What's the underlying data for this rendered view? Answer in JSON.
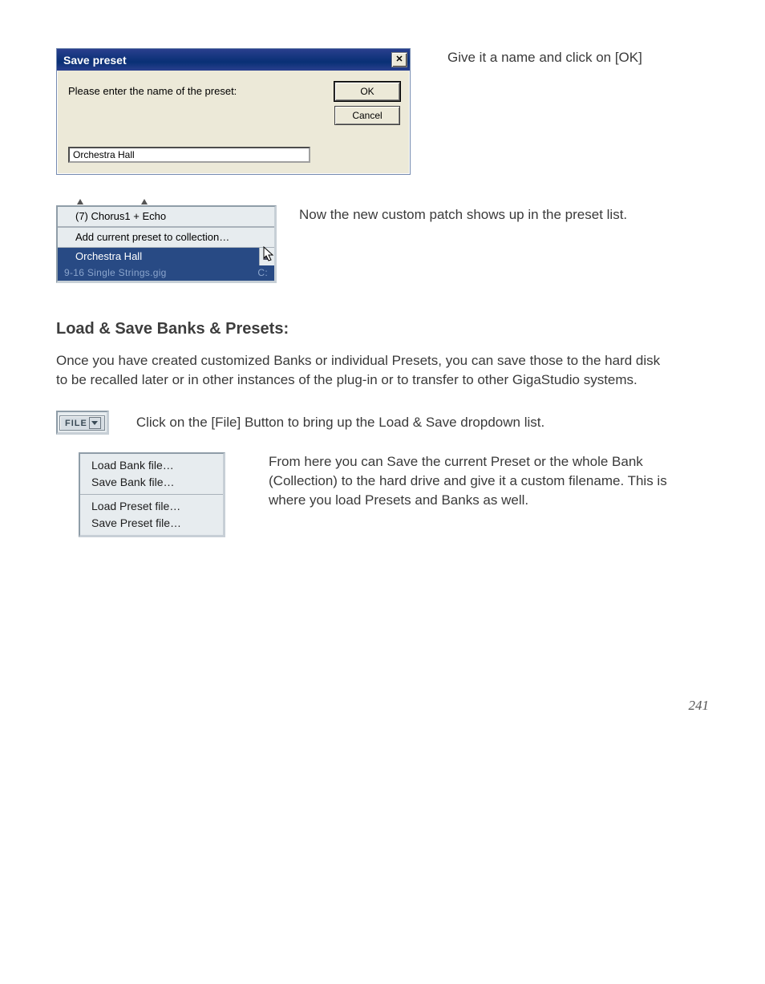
{
  "caption1": "Give it a name and click on [OK]",
  "save_dialog": {
    "title": "Save preset",
    "prompt": "Please enter the name of the preset:",
    "ok_label": "OK",
    "cancel_label": "Cancel",
    "value": "Orchestra Hall"
  },
  "caption2": "Now the new custom patch shows up in the preset list.",
  "preset_panel": {
    "row1": "(7) Chorus1 + Echo",
    "row2": "Add current preset to collection…",
    "selected": "Orchestra Hall",
    "bottom_left": "9-16 Single Strings.gig",
    "bottom_right": "C:"
  },
  "section_heading": "Load & Save Banks & Presets:",
  "body_para": "Once you have created customized Banks or individual Presets, you can save those to the hard disk to be recalled later or in other instances of the plug-in or to transfer to other GigaStudio systems.",
  "file_button_label": "FILE",
  "file_caption": "Click on the [File] Button to bring up the Load & Save dropdown list.",
  "menu4": {
    "load_bank": "Load Bank file…",
    "save_bank": "Save Bank file…",
    "load_preset": "Load Preset file…",
    "save_preset": "Save Preset file…"
  },
  "menu4_caption": "From here you can Save the current Preset or the whole Bank (Collection) to the hard drive and give it a custom filename.  This is where you load Presets and Banks as well.",
  "page_number": "241"
}
